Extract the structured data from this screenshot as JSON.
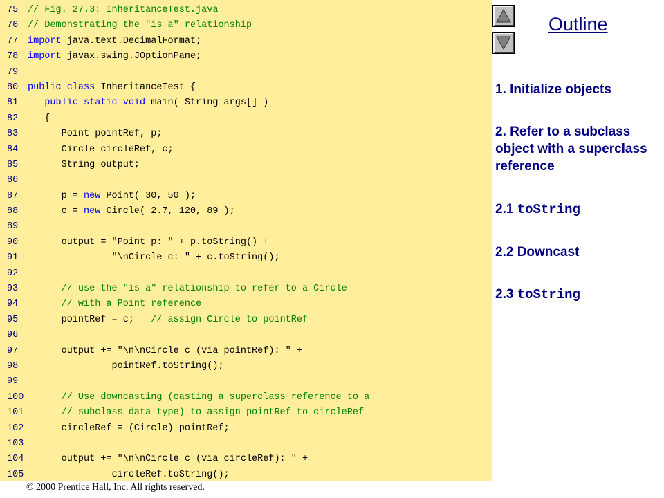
{
  "colors": {
    "code_bg": "#ffee9c",
    "line_number": "#000080",
    "comment": "#008000",
    "keyword": "#0000ff",
    "plain": "#000000",
    "outline_text": "#000080"
  },
  "code": {
    "lines": [
      {
        "n": "75",
        "segs": [
          {
            "t": "// Fig. 27.3: InheritanceTest.java",
            "c": "comment"
          }
        ]
      },
      {
        "n": "76",
        "segs": [
          {
            "t": "// Demonstrating the \"is a\" relationship",
            "c": "comment"
          }
        ]
      },
      {
        "n": "77",
        "segs": [
          {
            "t": "import",
            "c": "keyword"
          },
          {
            "t": " java.text.DecimalFormat;",
            "c": "plain"
          }
        ]
      },
      {
        "n": "78",
        "segs": [
          {
            "t": "import",
            "c": "keyword"
          },
          {
            "t": " javax.swing.JOptionPane;",
            "c": "plain"
          }
        ]
      },
      {
        "n": "79",
        "segs": []
      },
      {
        "n": "80",
        "segs": [
          {
            "t": "public class",
            "c": "keyword"
          },
          {
            "t": " InheritanceTest {",
            "c": "plain"
          }
        ]
      },
      {
        "n": "81",
        "segs": [
          {
            "t": "   ",
            "c": "plain"
          },
          {
            "t": "public static void",
            "c": "keyword"
          },
          {
            "t": " main( String args[] )",
            "c": "plain"
          }
        ]
      },
      {
        "n": "82",
        "segs": [
          {
            "t": "   {",
            "c": "plain"
          }
        ]
      },
      {
        "n": "83",
        "segs": [
          {
            "t": "      Point pointRef, p;",
            "c": "plain"
          }
        ]
      },
      {
        "n": "84",
        "segs": [
          {
            "t": "      Circle circleRef, c;",
            "c": "plain"
          }
        ]
      },
      {
        "n": "85",
        "segs": [
          {
            "t": "      String output;",
            "c": "plain"
          }
        ]
      },
      {
        "n": "86",
        "segs": []
      },
      {
        "n": "87",
        "segs": [
          {
            "t": "      p = ",
            "c": "plain"
          },
          {
            "t": "new",
            "c": "keyword"
          },
          {
            "t": " Point( 30, 50 );",
            "c": "plain"
          }
        ]
      },
      {
        "n": "88",
        "segs": [
          {
            "t": "      c = ",
            "c": "plain"
          },
          {
            "t": "new",
            "c": "keyword"
          },
          {
            "t": " Circle( 2.7, 120, 89 );",
            "c": "plain"
          }
        ]
      },
      {
        "n": "89",
        "segs": []
      },
      {
        "n": "90",
        "segs": [
          {
            "t": "      output = \"Point p: \" + p.toString() +",
            "c": "plain"
          }
        ]
      },
      {
        "n": "91",
        "segs": [
          {
            "t": "               \"\\nCircle c: \" + c.toString();",
            "c": "plain"
          }
        ]
      },
      {
        "n": "92",
        "segs": []
      },
      {
        "n": "93",
        "segs": [
          {
            "t": "      // use the \"is a\" relationship to refer to a Circle",
            "c": "comment"
          }
        ]
      },
      {
        "n": "94",
        "segs": [
          {
            "t": "      // with a Point reference",
            "c": "comment"
          }
        ]
      },
      {
        "n": "95",
        "segs": [
          {
            "t": "      pointRef = c;   ",
            "c": "plain"
          },
          {
            "t": "// assign Circle to pointRef",
            "c": "comment"
          }
        ]
      },
      {
        "n": "96",
        "segs": []
      },
      {
        "n": "97",
        "segs": [
          {
            "t": "      output += \"\\n\\nCircle c (via pointRef): \" +",
            "c": "plain"
          }
        ]
      },
      {
        "n": "98",
        "segs": [
          {
            "t": "               pointRef.toString();",
            "c": "plain"
          }
        ]
      },
      {
        "n": "99",
        "segs": []
      },
      {
        "n": "100",
        "segs": [
          {
            "t": "      // Use downcasting (casting a superclass reference to a",
            "c": "comment"
          }
        ]
      },
      {
        "n": "101",
        "segs": [
          {
            "t": "      // subclass data type) to assign pointRef to circleRef",
            "c": "comment"
          }
        ]
      },
      {
        "n": "102",
        "segs": [
          {
            "t": "      circleRef = (Circle) pointRef;",
            "c": "plain"
          }
        ]
      },
      {
        "n": "103",
        "segs": []
      },
      {
        "n": "104",
        "segs": [
          {
            "t": "      output += \"\\n\\nCircle c (via circleRef): \" +",
            "c": "plain"
          }
        ]
      },
      {
        "n": "105",
        "segs": [
          {
            "t": "               circleRef.toString();",
            "c": "plain"
          }
        ]
      }
    ]
  },
  "nav": {
    "up_icon": "triangle-up",
    "down_icon": "triangle-down"
  },
  "outline": {
    "title": "Outline",
    "item1": "1. Initialize objects",
    "item2": "2. Refer to a subclass object with a superclass reference",
    "item3_num": "2.1 ",
    "item3_code": "toString",
    "item4": "2.2 Downcast",
    "item5_num": "2.3 ",
    "item5_code": "toString"
  },
  "footer": {
    "copyright_symbol": "©",
    "text": " 2000 Prentice Hall, Inc.  All rights reserved."
  }
}
